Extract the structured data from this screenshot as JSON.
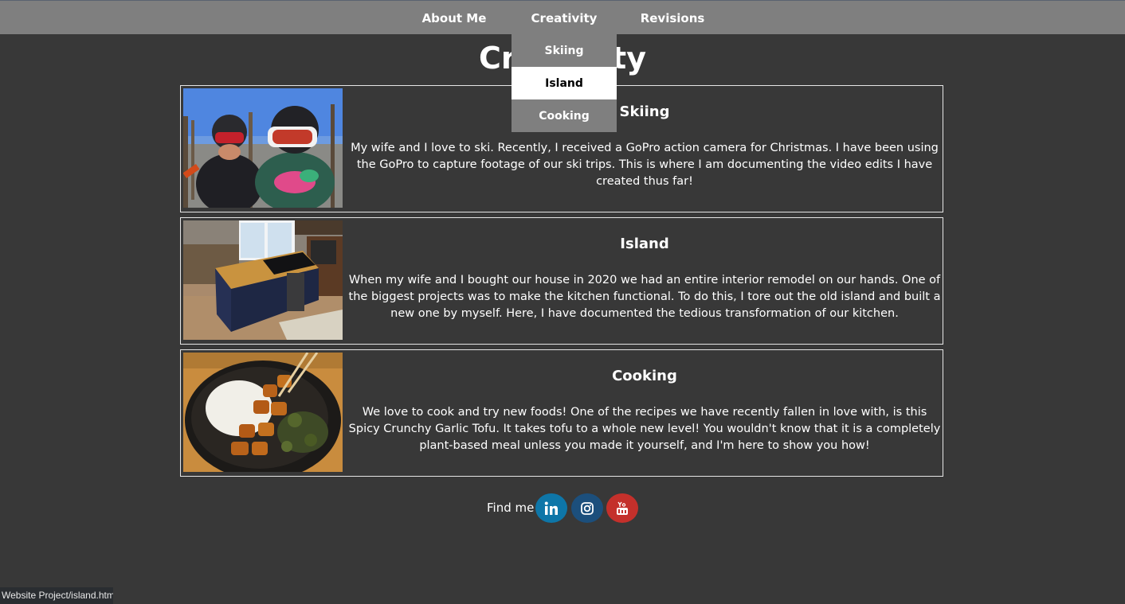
{
  "nav": {
    "about_label": "About Me",
    "creativity_label": "Creativity",
    "revisions_label": "Revisions"
  },
  "dropdown": {
    "items": [
      {
        "label": "Skiing",
        "active": false
      },
      {
        "label": "Island",
        "active": true
      },
      {
        "label": "Cooking",
        "active": false
      }
    ]
  },
  "page": {
    "title": "Creativity"
  },
  "cards": [
    {
      "title": "Skiing",
      "text": "My wife and I love to ski. Recently, I received a GoPro action camera for Christmas. I have been using the GoPro to capture footage of our ski trips. This is where I am documenting the video edits I have created thus far!"
    },
    {
      "title": "Island",
      "text": "When my wife and I bought our house in 2020 we had an entire interior remodel on our hands. One of the biggest projects was to make the kitchen functional. To do this, I tore out the old island and built a new one by myself. Here, I have documented the tedious transformation of our kitchen."
    },
    {
      "title": "Cooking",
      "text": "We love to cook and try new foods! One of the recipes we have recently fallen in love with, is this Spicy Crunchy Garlic Tofu. It takes tofu to a whole new level! You wouldn't know that it is a completely plant-based meal unless you made it yourself, and I'm here to show you how!"
    }
  ],
  "footer": {
    "find_me": "Find me",
    "social": [
      {
        "icon": "linkedin-icon",
        "color": "#0e76a8"
      },
      {
        "icon": "instagram-icon",
        "color": "#1c4f7c"
      },
      {
        "icon": "youtube-icon",
        "color": "#c4302b"
      }
    ]
  },
  "status_bar": {
    "url": "Website Project/island.html"
  },
  "colors": {
    "background": "#383838",
    "navbar": "#7f7f7f"
  }
}
